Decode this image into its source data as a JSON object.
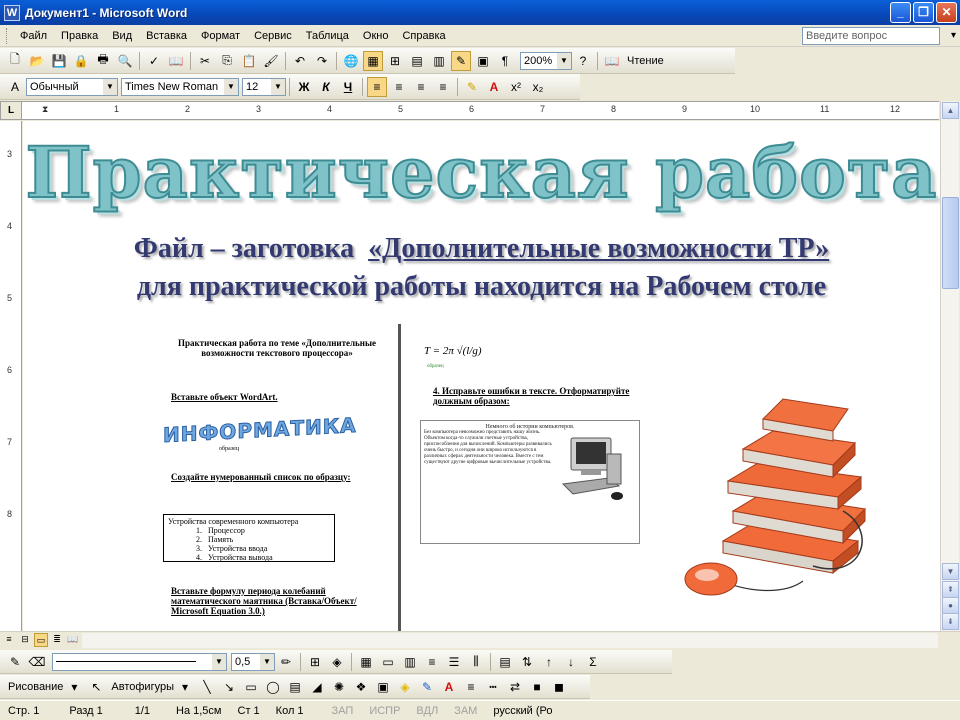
{
  "window": {
    "title": "Документ1 - Microsoft Word",
    "app_icon": "W"
  },
  "menu": [
    "Файл",
    "Правка",
    "Вид",
    "Вставка",
    "Формат",
    "Сервис",
    "Таблица",
    "Окно",
    "Справка"
  ],
  "help_box": {
    "placeholder": "Введите вопрос"
  },
  "toolbar": {
    "zoom": "200%",
    "reading_mode": "Чтение"
  },
  "format_toolbar": {
    "style": "Обычный",
    "font": "Times New Roman",
    "size": "12"
  },
  "ruler": {
    "numbers": [
      "1",
      "2",
      "3",
      "4",
      "5",
      "6",
      "7",
      "8",
      "9",
      "10",
      "11",
      "12"
    ],
    "v_numbers": [
      "3",
      "4",
      "5",
      "6",
      "7",
      "8"
    ]
  },
  "document": {
    "heading": "Практическая работа",
    "line1_prefix": "Файл – заготовка",
    "line1_link": "«Дополнительные возможности ТР»",
    "line2": "для практической работы находится на Рабочем столе",
    "preview": {
      "title": "Практическая работа по теме «Дополнительные возможности текстового процессора»",
      "task1": "Вставьте объект WordArt.",
      "wordart": "ИНФОРМАТИКА",
      "wordart_caption": "образец",
      "task2": "Создайте нумерованный список по образцу:",
      "list_title": "Устройства современного компьютера",
      "list_items": [
        "Процессор",
        "Память",
        "Устройства ввода",
        "Устройства вывода"
      ],
      "task3": "Вставьте формулу периода колебаний математического маятника (Вставка/Объект/ Microsoft Equation 3.0.)",
      "formula": "T = 2π √(l/g)",
      "formula_caption": "образец",
      "task4": "4. Исправьте ошибки в тексте. Отформатируйте должным образом:",
      "textbox_title": "Немного об истории компьютеров.",
      "textbox_body": "Без компьютера невозможно представить нашу жизнь. Объектом когда-то служили счетные устройства, приспособления для вычислений. Компьютеры развивались очень быстро, и сегодня они широко используются в различных сферах деятельности человека. Вместе с тем существуют другие цифровые вычислительные устройства."
    }
  },
  "draw_toolbar": {
    "line_width": "0,5",
    "drawing": "Рисование",
    "autoshapes": "Автофигуры"
  },
  "status": {
    "page": "Стр. 1",
    "section": "Разд 1",
    "pages": "1/1",
    "at": "На 1,5см",
    "line": "Ст 1",
    "col": "Кол 1",
    "rec": "ЗАП",
    "trk": "ИСПР",
    "ext": "ВДЛ",
    "ovr": "ЗАМ",
    "lang": "русский (Ро"
  }
}
